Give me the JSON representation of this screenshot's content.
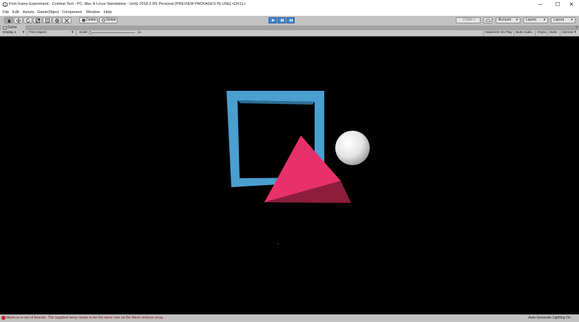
{
  "window": {
    "title": "First Game Experiment - Combat Test - PC, Mac & Linux Standalone - Unity 2018.2.0f1 Personal [PREVIEW PACKAGES IN USE] <DX11>",
    "minimize": "─",
    "maximize": "☐",
    "close": "✕"
  },
  "menu": [
    "File",
    "Edit",
    "Assets",
    "GameObject",
    "Component",
    "Window",
    "Help"
  ],
  "toolbar": {
    "pivot_label": "Center",
    "space_label": "Global",
    "collab_label": "Collab ▾",
    "account_label": "Account",
    "layers_label": "Layers",
    "layout_label": "Layout"
  },
  "game_tab": {
    "label": "Game"
  },
  "game_toolbar": {
    "display": "Display 1",
    "aspect": "Free Aspect",
    "scale_label": "Scale",
    "scale_value": "1x",
    "maximize_on_play": "Maximize On Play",
    "mute_audio": "Mute Audio",
    "vsync": "VSync",
    "stats": "Stats",
    "gizmos": "Gizmos"
  },
  "status": {
    "message": "Mesh.uv is out of bounds. The supplied array needs to be the same size as the Mesh.vertices array.",
    "right": "Auto Generate Lighting On"
  },
  "colors": {
    "frame_blue": "#4a9fd0",
    "pyramid_pink": "#e8316b",
    "pyramid_dark": "#8c1d3c"
  }
}
